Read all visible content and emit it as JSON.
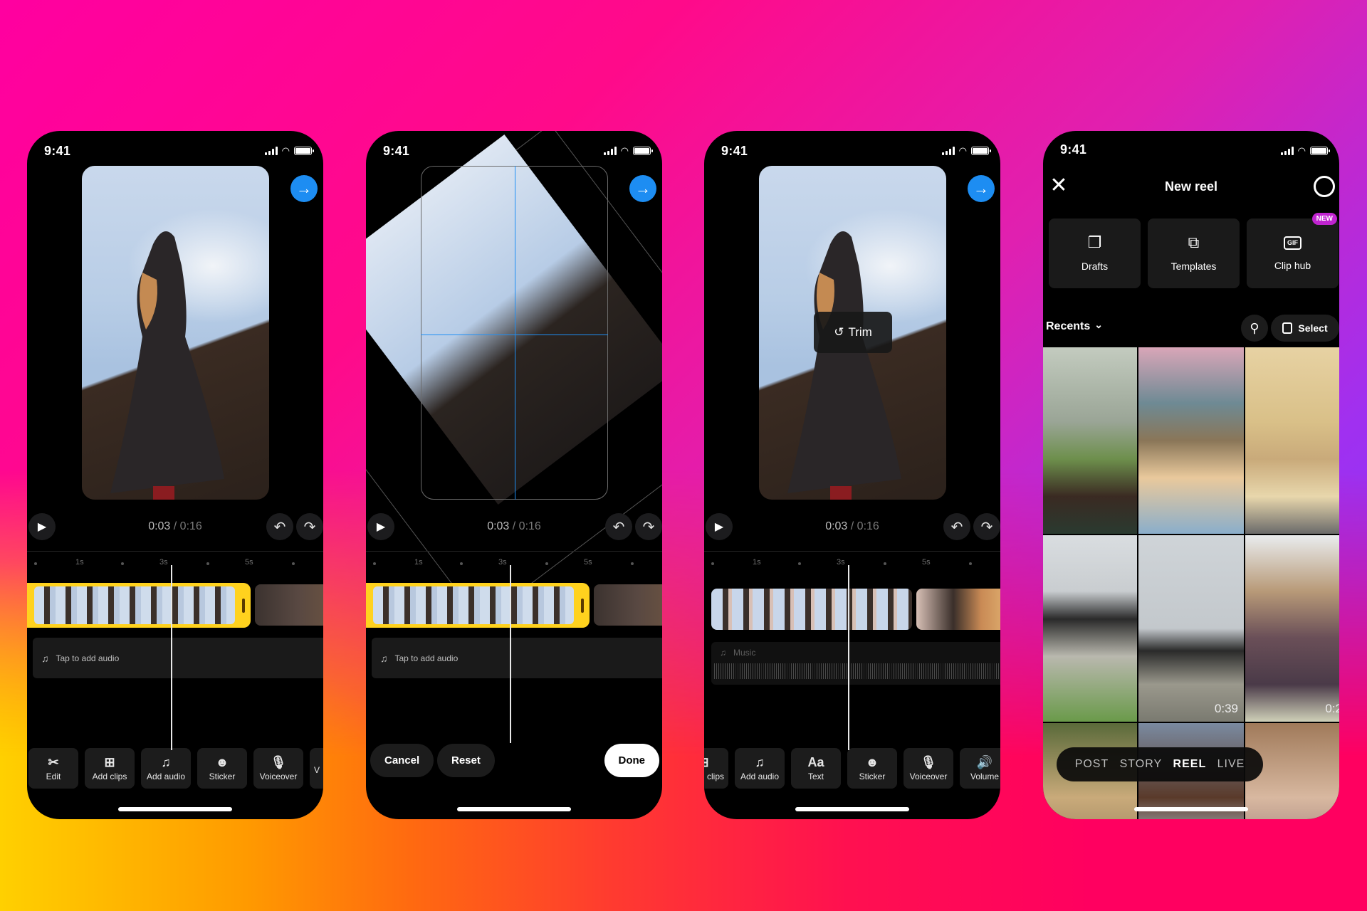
{
  "status_bar": {
    "time": "9:41"
  },
  "editor": {
    "current_time": "0:03",
    "separator": " / ",
    "total_time": "0:16",
    "ruler_labels": [
      "1s",
      "3s",
      "5s"
    ],
    "audio_placeholder": "Tap to add audio",
    "next_icon": "→",
    "undo_icon": "↶",
    "redo_icon": "↷",
    "play_icon": "▶"
  },
  "phone1": {
    "toolbar": [
      {
        "label": "Edit",
        "icon": "scissors-icon",
        "glyph": "✂"
      },
      {
        "label": "Add clips",
        "icon": "add-clip-icon",
        "glyph": "⊞"
      },
      {
        "label": "Add audio",
        "icon": "add-audio-icon",
        "glyph": "♫"
      },
      {
        "label": "Sticker",
        "icon": "sticker-icon",
        "glyph": "☻"
      },
      {
        "label": "Voiceover",
        "icon": "microphone-icon",
        "glyph": "🎙"
      },
      {
        "label": "V",
        "icon": "partial-icon",
        "glyph": ""
      }
    ]
  },
  "phone2": {
    "cancel_label": "Cancel",
    "reset_label": "Reset",
    "done_label": "Done"
  },
  "phone3": {
    "trim_label": "Trim",
    "trim_icon": "↺",
    "music_label": "Music",
    "toolbar": [
      {
        "label": "clips",
        "icon": "add-clip-icon",
        "glyph": "⊞"
      },
      {
        "label": "Add audio",
        "icon": "add-audio-icon",
        "glyph": "♫"
      },
      {
        "label": "Text",
        "icon": "text-icon",
        "glyph": "Aa"
      },
      {
        "label": "Sticker",
        "icon": "sticker-icon",
        "glyph": "☻"
      },
      {
        "label": "Voiceover",
        "icon": "microphone-icon",
        "glyph": "🎙"
      },
      {
        "label": "Volume",
        "icon": "volume-icon",
        "glyph": "🔊"
      }
    ]
  },
  "phone4": {
    "title": "New reel",
    "close_icon": "✕",
    "shortcuts": [
      {
        "label": "Drafts",
        "glyph": "❐"
      },
      {
        "label": "Templates",
        "glyph": "⧉"
      },
      {
        "label": "Clip hub",
        "glyph": "GIF",
        "badge": "NEW"
      }
    ],
    "recents_label": "Recents",
    "recents_chevron": "⌄",
    "search_icon": "⚲",
    "select_label": "Select",
    "gallery": [
      {
        "duration": ""
      },
      {
        "duration": ""
      },
      {
        "duration": ""
      },
      {
        "duration": ""
      },
      {
        "duration": "0:39"
      },
      {
        "duration": "0:2"
      },
      {
        "duration": ""
      },
      {
        "duration": ""
      },
      {
        "duration": ""
      }
    ],
    "modes": [
      "POST",
      "STORY",
      "REEL",
      "LIVE"
    ],
    "active_mode": "REEL"
  },
  "colors": {
    "accent_blue": "#1d8df2",
    "clip_selected_yellow": "#ffd21e",
    "new_badge": "#c024d0"
  }
}
